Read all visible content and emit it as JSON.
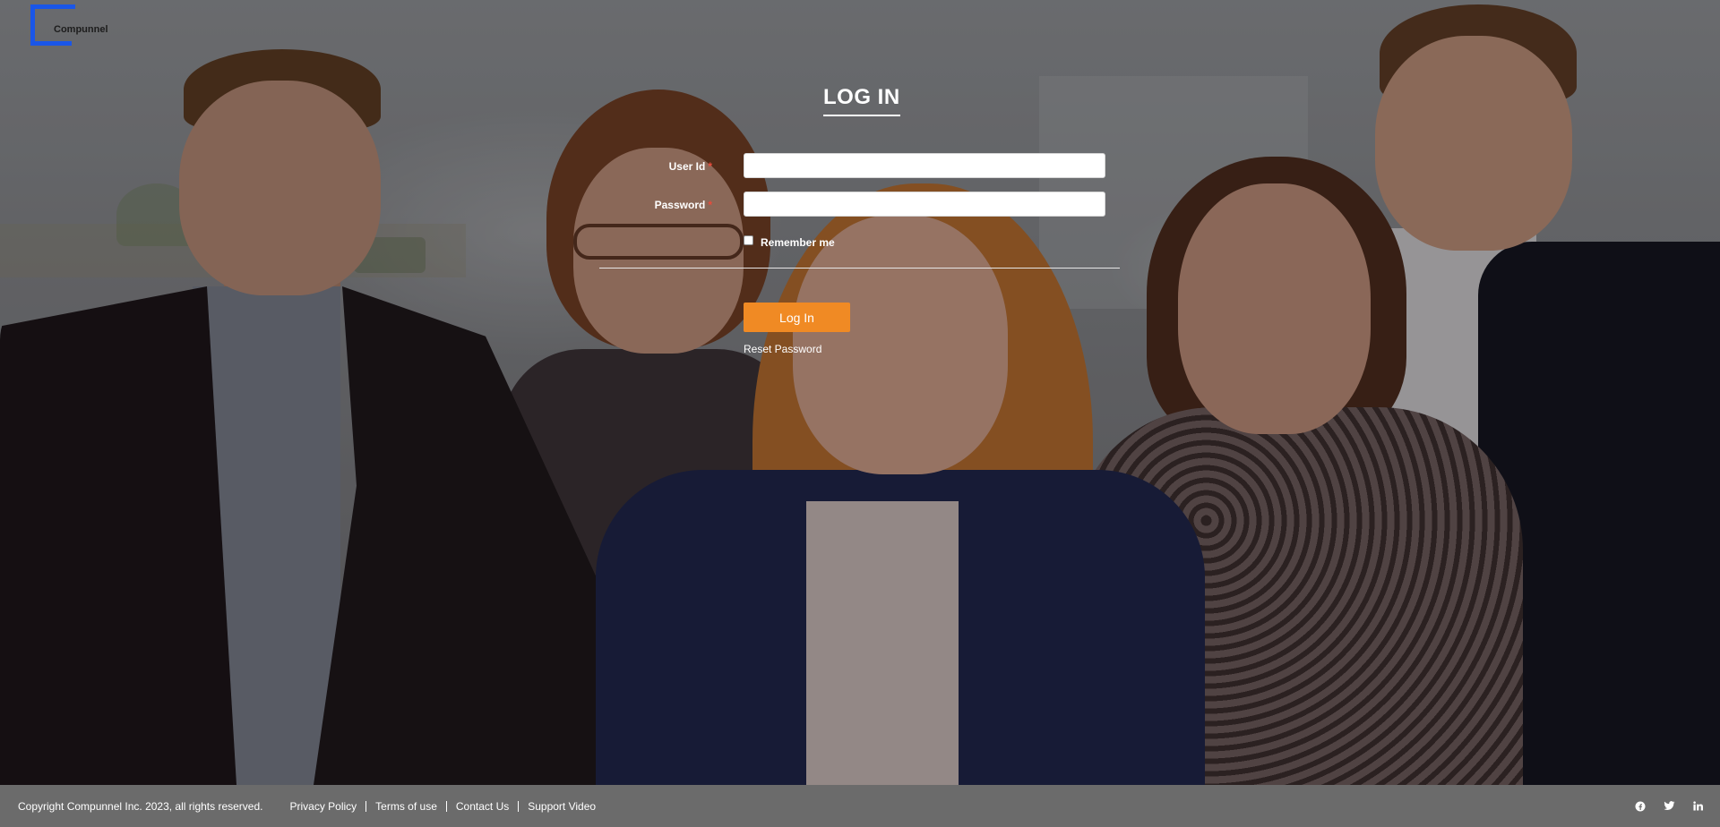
{
  "brand": {
    "name": "Compunnel"
  },
  "login": {
    "title": "LOG IN",
    "user_id_label": "User Id",
    "password_label": "Password",
    "required_mark": "*",
    "user_id_value": "",
    "password_value": "",
    "remember_label": "Remember me",
    "remember_checked": false,
    "submit_label": "Log In",
    "reset_label": "Reset Password"
  },
  "footer": {
    "copyright": "Copyright Compunnel Inc. 2023, all rights reserved.",
    "links": [
      "Privacy Policy",
      "Terms of use",
      "Contact Us",
      "Support Video"
    ],
    "social_icons": [
      "facebook-icon",
      "twitter-icon",
      "linkedin-icon"
    ]
  },
  "colors": {
    "brand_blue": "#1a56e8",
    "button_orange": "#f08a24",
    "footer_gray": "#6b6b6b",
    "required_red": "#e84b3c"
  }
}
